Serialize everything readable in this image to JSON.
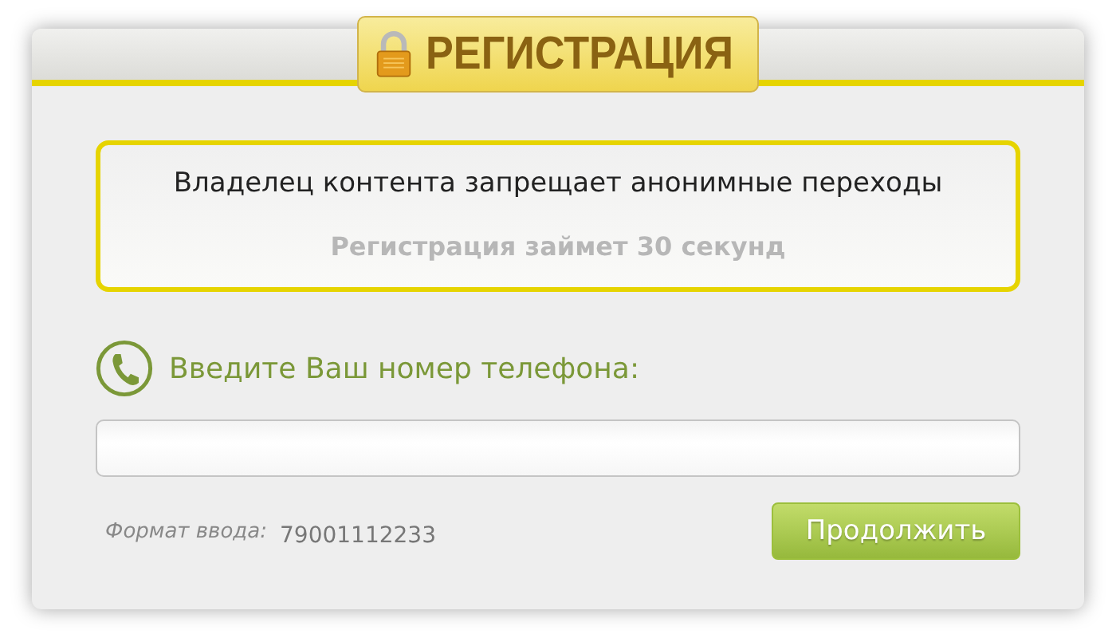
{
  "header": {
    "title": "РЕГИСТРАЦИЯ"
  },
  "notice": {
    "message": "Владелец контента запрещает анонимные переходы",
    "subtitle": "Регистрация займет 30 секунд"
  },
  "phone": {
    "label": "Введите Ваш номер телефона:"
  },
  "format": {
    "label": "Формат ввода:",
    "example": "79001112233"
  },
  "buttons": [
    "Продолжить"
  ]
}
